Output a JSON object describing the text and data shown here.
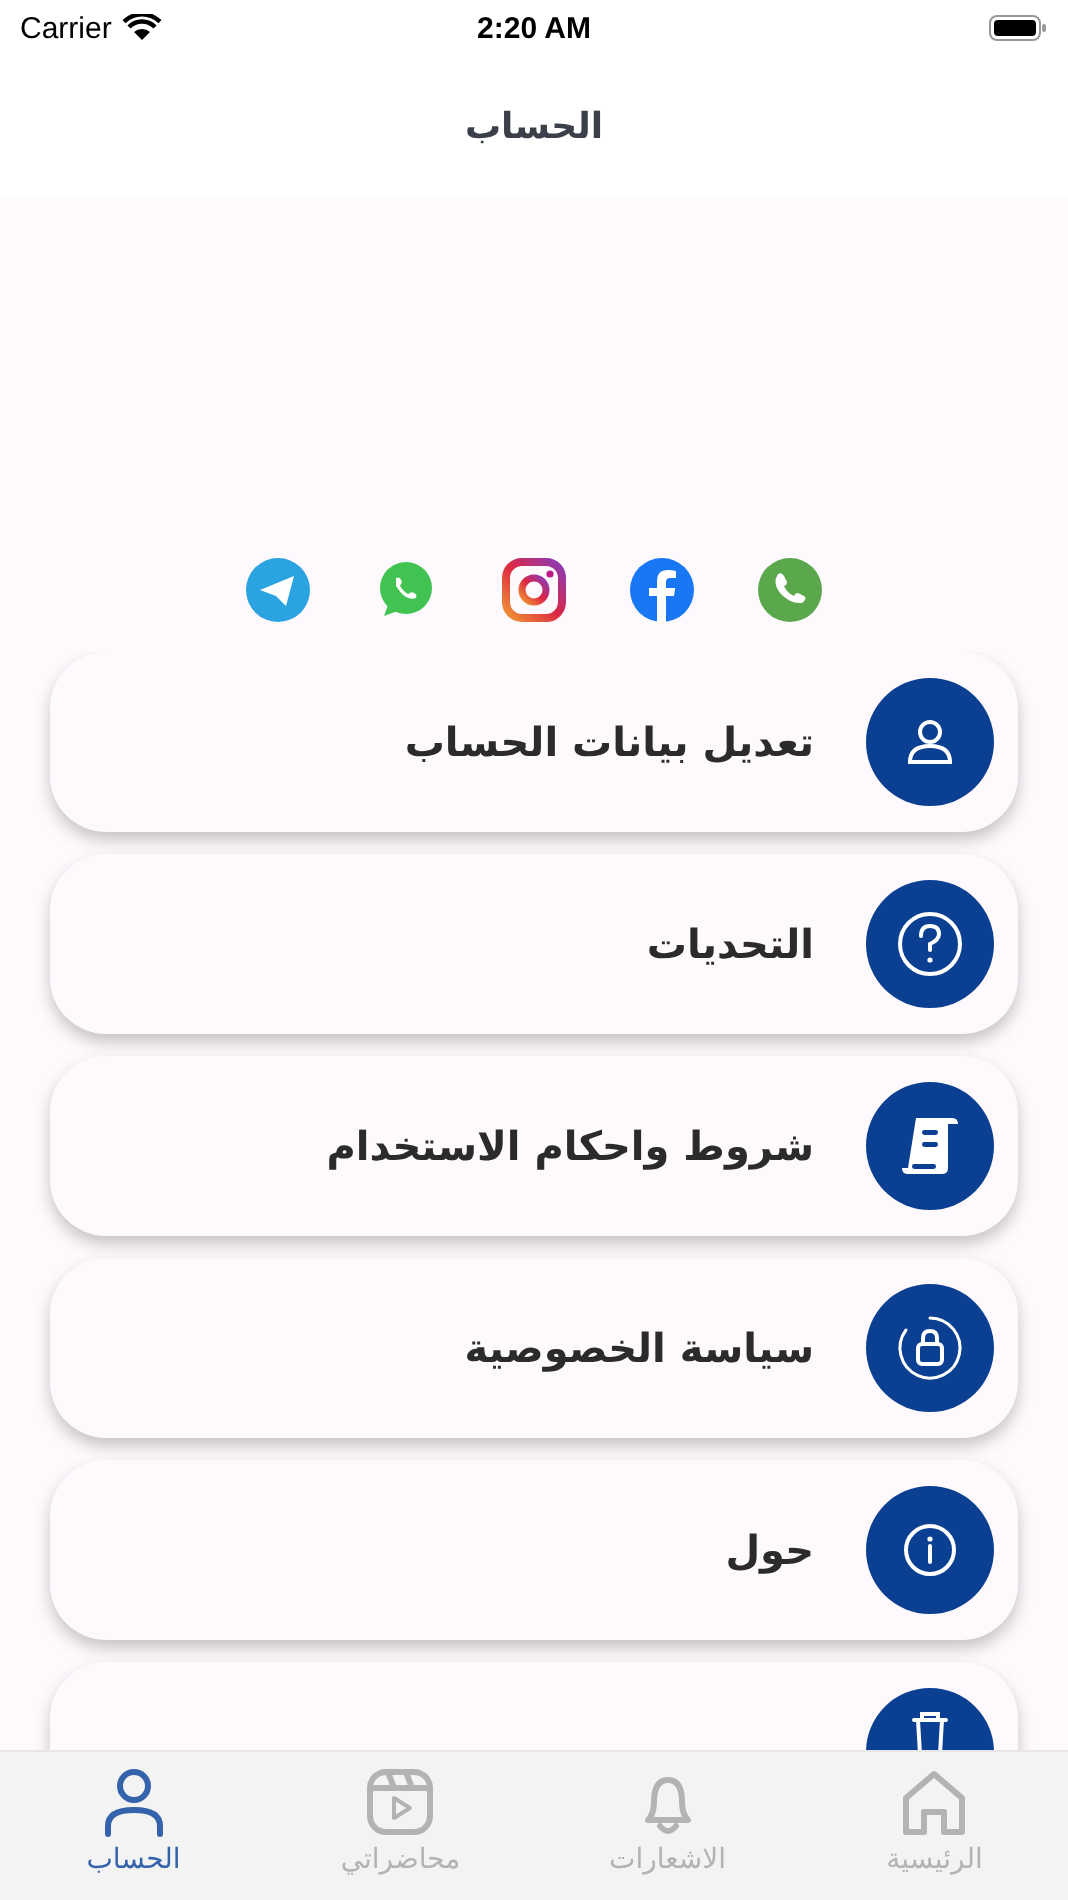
{
  "status_bar": {
    "carrier": "Carrier",
    "time": "2:20 AM"
  },
  "header": {
    "title": "الحساب"
  },
  "social": [
    {
      "kind": "telegram"
    },
    {
      "kind": "whatsapp"
    },
    {
      "kind": "instagram"
    },
    {
      "kind": "facebook"
    },
    {
      "kind": "phone"
    }
  ],
  "menu": [
    {
      "kind": "user",
      "label": "تعديل بيانات الحساب"
    },
    {
      "kind": "question",
      "label": "التحديات"
    },
    {
      "kind": "scroll",
      "label": "شروط واحكام الاستخدام"
    },
    {
      "kind": "lock",
      "label": "سياسة الخصوصية"
    },
    {
      "kind": "info",
      "label": "حول"
    },
    {
      "kind": "trash"
    }
  ],
  "tab_bar": [
    {
      "kind": "home",
      "label": "الرئيسية",
      "selected": false
    },
    {
      "kind": "bell",
      "label": "الاشعارات",
      "selected": false
    },
    {
      "kind": "reel",
      "label": "محاضراتي",
      "selected": false
    },
    {
      "kind": "user",
      "label": "الحساب",
      "selected": true
    }
  ]
}
